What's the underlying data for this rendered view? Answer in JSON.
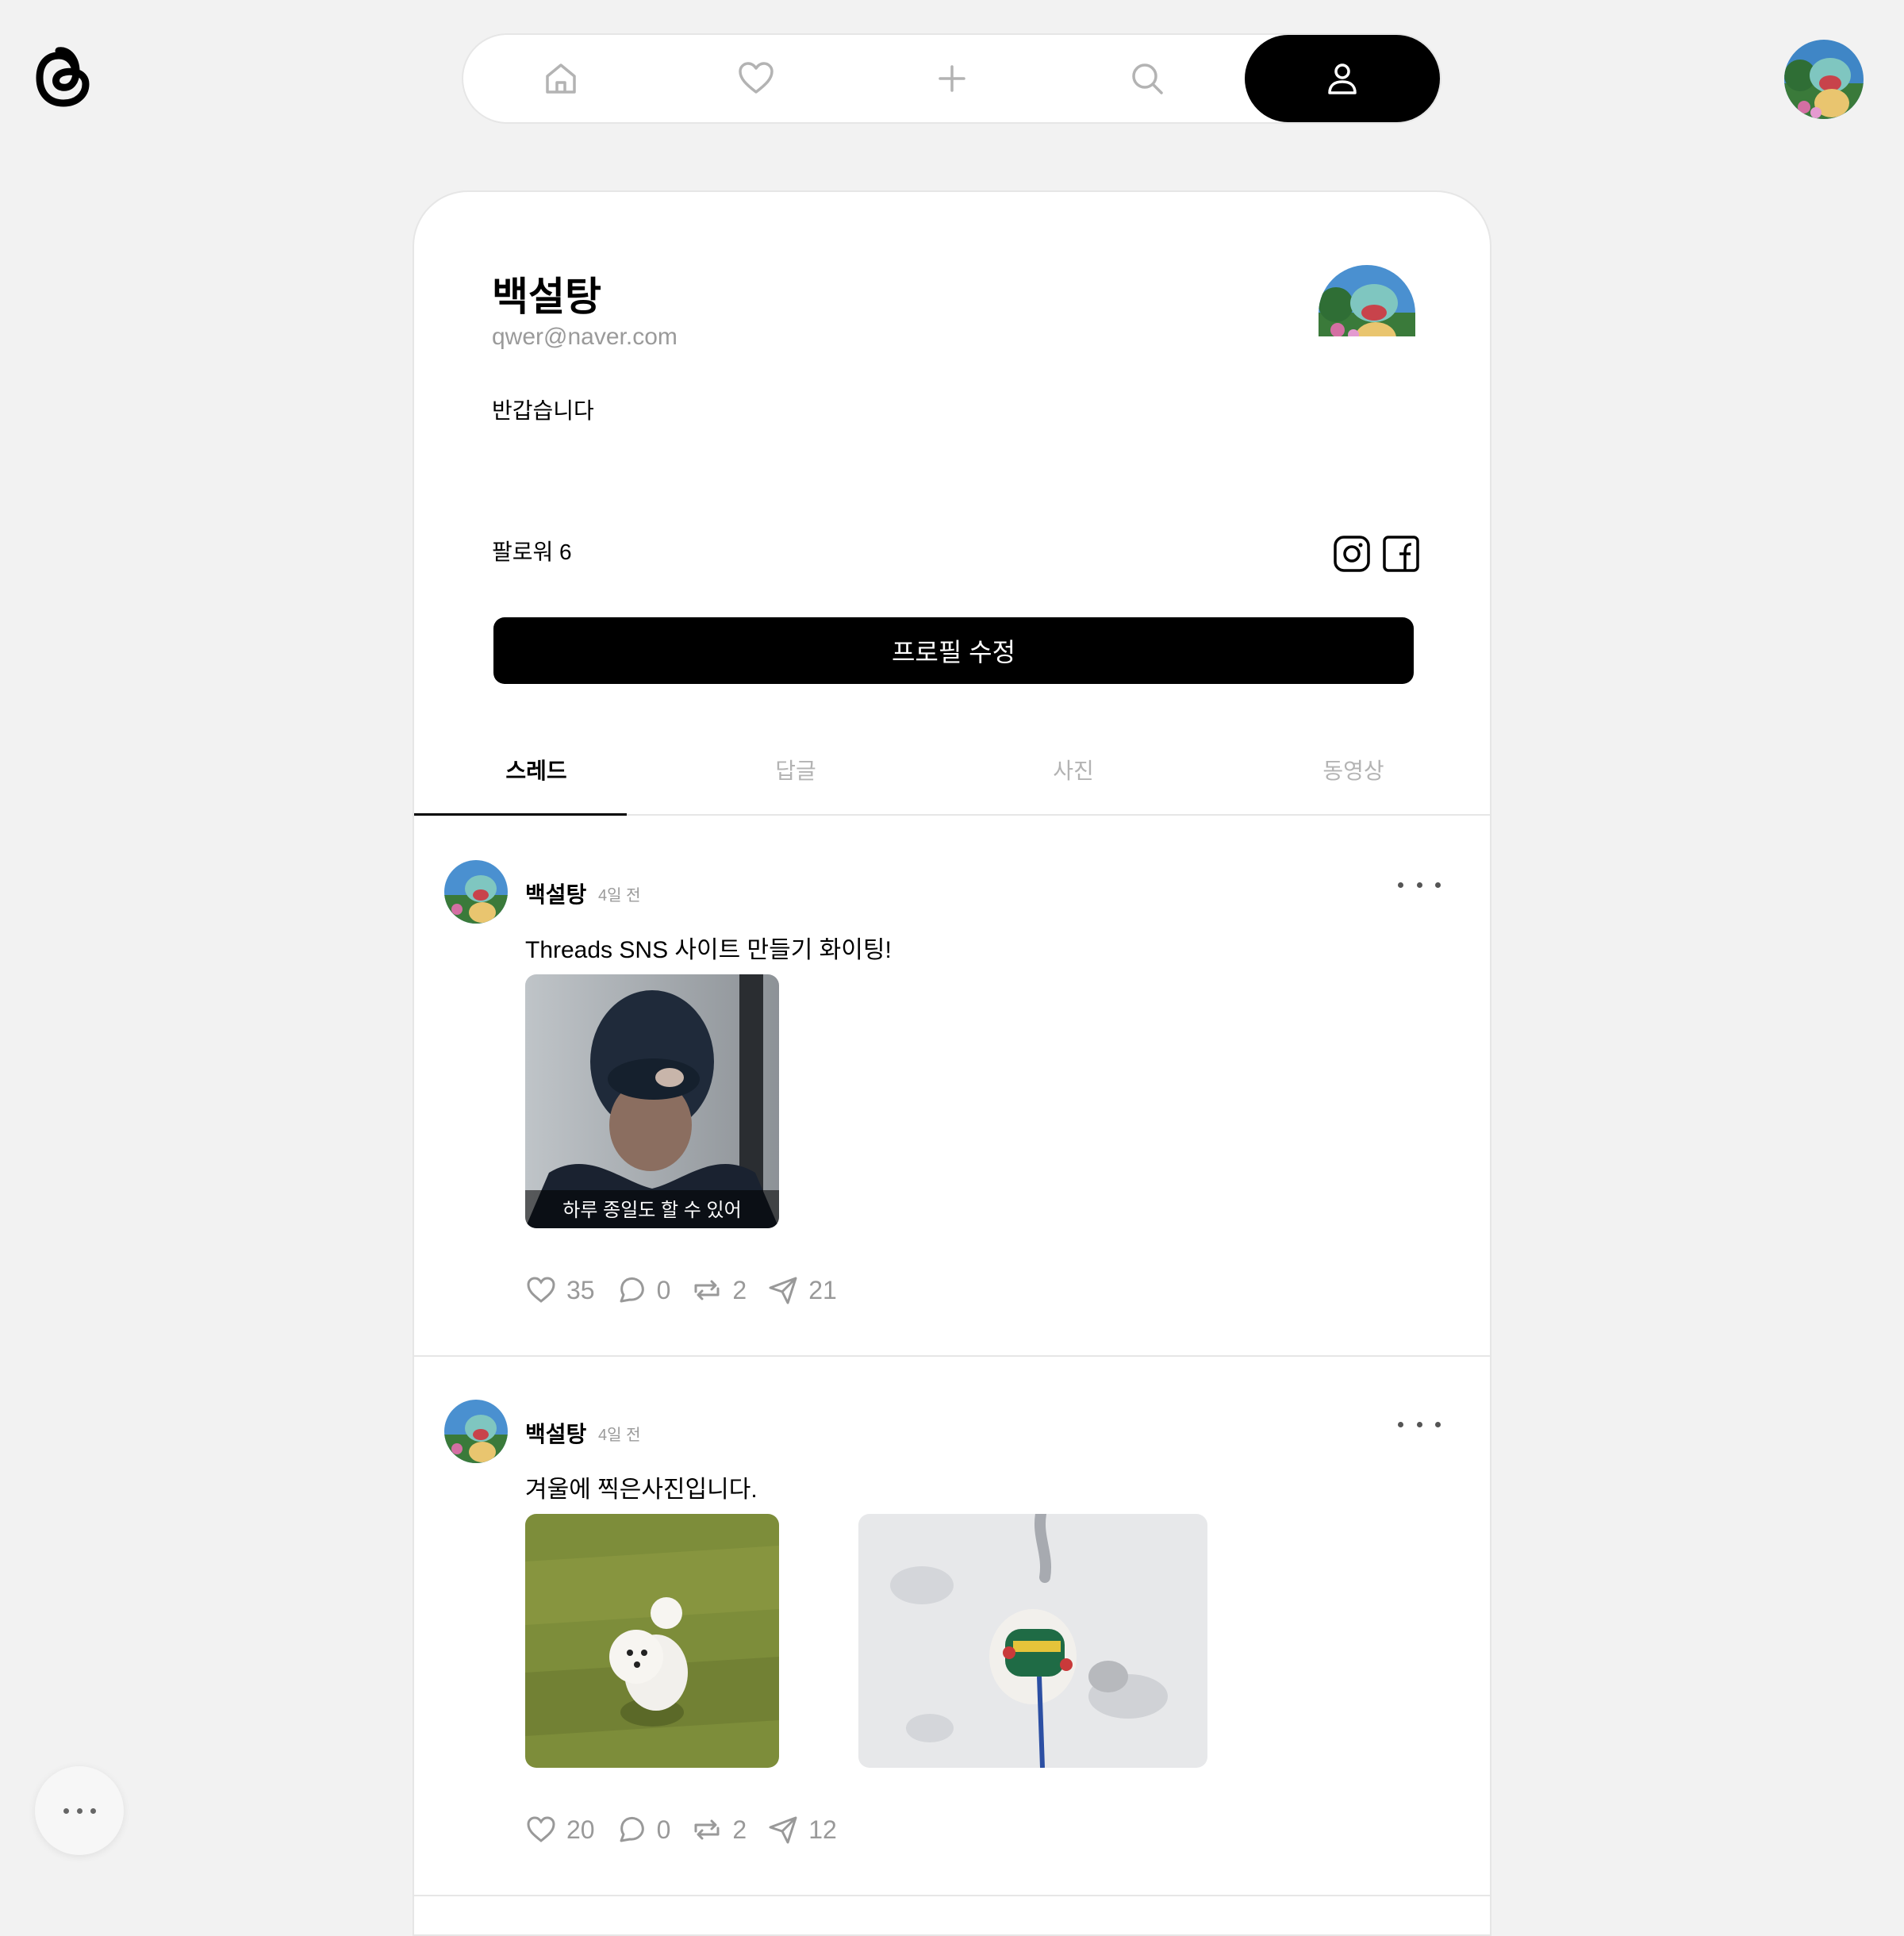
{
  "nav": {
    "items": [
      {
        "icon": "home-icon",
        "active": false
      },
      {
        "icon": "heart-icon",
        "active": false
      },
      {
        "icon": "plus-icon",
        "active": false
      },
      {
        "icon": "search-icon",
        "active": false
      },
      {
        "icon": "user-icon",
        "active": true
      }
    ]
  },
  "profile": {
    "name": "백설탕",
    "email": "qwer@naver.com",
    "bio": "반갑습니다",
    "followers_label": "팔로워 6",
    "edit_button": "프로필 수정"
  },
  "tabs": [
    {
      "label": "스레드",
      "active": true
    },
    {
      "label": "답글",
      "active": false
    },
    {
      "label": "사진",
      "active": false
    },
    {
      "label": "동영상",
      "active": false
    }
  ],
  "posts": [
    {
      "author": "백설탕",
      "time": "4일 전",
      "text": "Threads SNS 사이트 만들기 화이팅!",
      "image_caption": "하루 종일도 할 수 있어",
      "likes": "35",
      "comments": "0",
      "reposts": "2",
      "shares": "21"
    },
    {
      "author": "백설탕",
      "time": "4일 전",
      "text": "겨울에 찍은사진입니다.",
      "likes": "20",
      "comments": "0",
      "reposts": "2",
      "shares": "12"
    }
  ],
  "colors": {
    "background": "#f2f2f2",
    "card": "#ffffff",
    "accent": "#000000",
    "muted": "#9a9a9a"
  }
}
